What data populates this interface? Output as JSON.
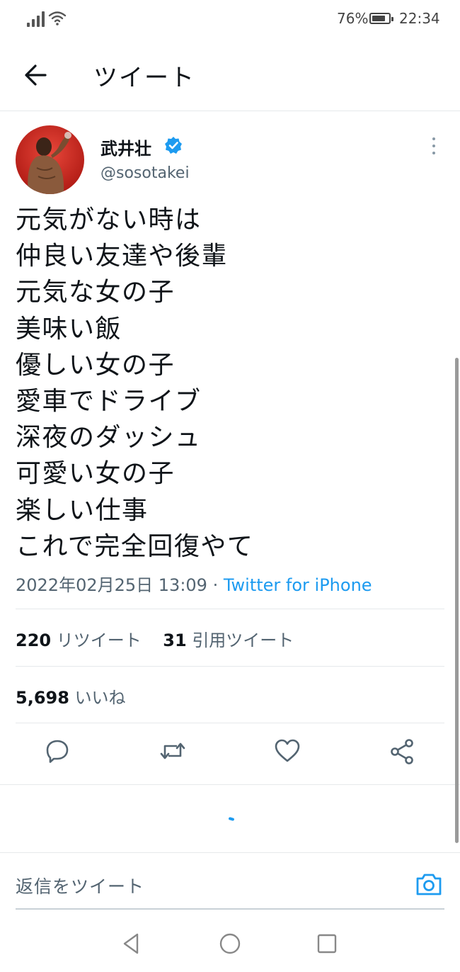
{
  "status_bar": {
    "battery_percent": "76%",
    "time": "22:34"
  },
  "header": {
    "title": "ツイート",
    "back_icon": "arrow-left-icon"
  },
  "tweet": {
    "author_name": "武井壮",
    "handle": "@sosotakei",
    "verified": true,
    "lines": [
      "元気がない時は",
      "仲良い友達や後輩",
      "元気な女の子",
      "美味い飯",
      "優しい女の子",
      "愛車でドライブ",
      "深夜のダッシュ",
      "可愛い女の子",
      "楽しい仕事",
      "これで完全回復やて"
    ],
    "timestamp": "2022年02月25日 13:09",
    "separator": " · ",
    "source": "Twitter for iPhone",
    "retweets_count": "220",
    "retweets_label": "リツイート",
    "quotes_count": "31",
    "quotes_label": "引用ツイート",
    "likes_count": "5,698",
    "likes_label": "いいね"
  },
  "actions": {
    "reply_icon": "reply-icon",
    "retweet_icon": "retweet-icon",
    "like_icon": "heart-icon",
    "share_icon": "share-icon"
  },
  "reply_bar": {
    "placeholder": "返信をツイート",
    "camera_icon": "camera-icon"
  },
  "colors": {
    "accent": "#1d9bf0",
    "text_primary": "#0f1419",
    "text_secondary": "#536471"
  }
}
